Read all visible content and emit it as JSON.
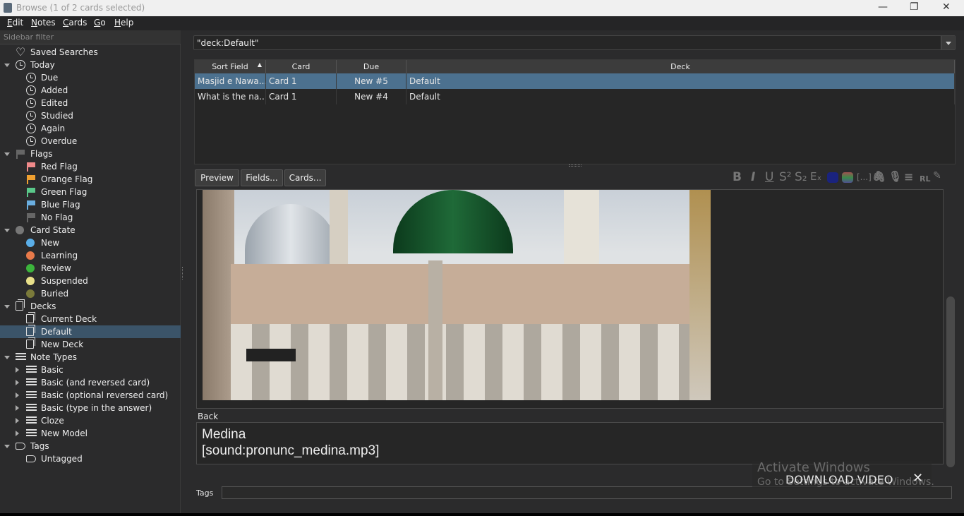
{
  "window": {
    "title": "Browse (1 of 2 cards selected)"
  },
  "menu": [
    "Edit",
    "Notes",
    "Cards",
    "Go",
    "Help"
  ],
  "sidebar": {
    "filter_placeholder": "Sidebar filter",
    "items": [
      {
        "label": "Saved Searches",
        "icon": "heart-icon",
        "level": 0,
        "arrow": ""
      },
      {
        "label": "Today",
        "icon": "clock-icon",
        "level": 0,
        "arrow": "open"
      },
      {
        "label": "Due",
        "icon": "clock-icon",
        "level": 1,
        "arrow": ""
      },
      {
        "label": "Added",
        "icon": "clock-icon",
        "level": 1,
        "arrow": ""
      },
      {
        "label": "Edited",
        "icon": "clock-icon",
        "level": 1,
        "arrow": ""
      },
      {
        "label": "Studied",
        "icon": "clock-icon",
        "level": 1,
        "arrow": ""
      },
      {
        "label": "Again",
        "icon": "clock-icon",
        "level": 1,
        "arrow": ""
      },
      {
        "label": "Overdue",
        "icon": "clock-icon",
        "level": 1,
        "arrow": ""
      },
      {
        "label": "Flags",
        "icon": "flag-icon",
        "color": "#666666",
        "level": 0,
        "arrow": "open"
      },
      {
        "label": "Red Flag",
        "icon": "flag-icon",
        "color": "#f08a8a",
        "level": 1,
        "arrow": ""
      },
      {
        "label": "Orange Flag",
        "icon": "flag-icon",
        "color": "#f0a030",
        "level": 1,
        "arrow": ""
      },
      {
        "label": "Green Flag",
        "icon": "flag-icon",
        "color": "#5ac88a",
        "level": 1,
        "arrow": ""
      },
      {
        "label": "Blue Flag",
        "icon": "flag-icon",
        "color": "#6aaee0",
        "level": 1,
        "arrow": ""
      },
      {
        "label": "No Flag",
        "icon": "flag-icon",
        "color": "#666666",
        "level": 1,
        "arrow": ""
      },
      {
        "label": "Card State",
        "icon": "circle-icon",
        "color": "#777777",
        "level": 0,
        "arrow": "open"
      },
      {
        "label": "New",
        "icon": "circle-icon",
        "color": "#5aaee8",
        "level": 1,
        "arrow": ""
      },
      {
        "label": "Learning",
        "icon": "circle-icon",
        "color": "#e87a4a",
        "level": 1,
        "arrow": ""
      },
      {
        "label": "Review",
        "icon": "circle-icon",
        "color": "#3cb43c",
        "level": 1,
        "arrow": ""
      },
      {
        "label": "Suspended",
        "icon": "circle-icon",
        "color": "#e8e08a",
        "level": 1,
        "arrow": ""
      },
      {
        "label": "Buried",
        "icon": "circle-icon",
        "color": "#7a7a3a",
        "level": 1,
        "arrow": ""
      },
      {
        "label": "Decks",
        "icon": "deck-icon",
        "level": 0,
        "arrow": "open"
      },
      {
        "label": "Current Deck",
        "icon": "deck-icon",
        "level": 1,
        "arrow": ""
      },
      {
        "label": "Default",
        "icon": "deck-icon",
        "level": 1,
        "arrow": "",
        "selected": true
      },
      {
        "label": "New Deck",
        "icon": "deck-icon",
        "level": 1,
        "arrow": ""
      },
      {
        "label": "Note Types",
        "icon": "note-type-icon",
        "level": 0,
        "arrow": "open"
      },
      {
        "label": "Basic",
        "icon": "note-type-icon",
        "level": 1,
        "arrow": "closed"
      },
      {
        "label": "Basic (and reversed card)",
        "icon": "note-type-icon",
        "level": 1,
        "arrow": "closed"
      },
      {
        "label": "Basic (optional reversed card)",
        "icon": "note-type-icon",
        "level": 1,
        "arrow": "closed"
      },
      {
        "label": "Basic (type in the answer)",
        "icon": "note-type-icon",
        "level": 1,
        "arrow": "closed"
      },
      {
        "label": "Cloze",
        "icon": "note-type-icon",
        "level": 1,
        "arrow": "closed"
      },
      {
        "label": "New Model",
        "icon": "note-type-icon",
        "level": 1,
        "arrow": "closed"
      },
      {
        "label": "Tags",
        "icon": "tag-icon",
        "level": 0,
        "arrow": "open"
      },
      {
        "label": "Untagged",
        "icon": "tag-icon",
        "level": 1,
        "arrow": ""
      }
    ]
  },
  "search": {
    "value": "\"deck:Default\""
  },
  "table": {
    "columns": [
      "Sort Field",
      "Card",
      "Due",
      "Deck"
    ],
    "sort_column": "Sort Field",
    "rows": [
      [
        "Masjid e Nawa...",
        "Card 1",
        "New #5",
        "Default"
      ],
      [
        "What is the na...",
        "Card 1",
        "New #4",
        "Default"
      ]
    ],
    "selected_row": 0
  },
  "editor": {
    "buttons": {
      "preview": "Preview",
      "fields": "Fields...",
      "cards": "Cards..."
    },
    "toolbar": {
      "bold": "B",
      "italic": "I",
      "underline": "U",
      "superscript": "S²",
      "subscript": "S₂",
      "clear": "Eₓ",
      "cloze": "[...]",
      "rtl": "RL"
    },
    "text_color": "#1a237e",
    "back_label": "Back",
    "back_lines": [
      "Medina",
      "[sound:pronunc_medina.mp3]"
    ],
    "tags_label": "Tags"
  },
  "overlay": {
    "activate_title": "Activate Windows",
    "activate_sub": "Go to Settings to activate Windows.",
    "download_label": "DOWNLOAD VIDEO",
    "close": "✕"
  }
}
